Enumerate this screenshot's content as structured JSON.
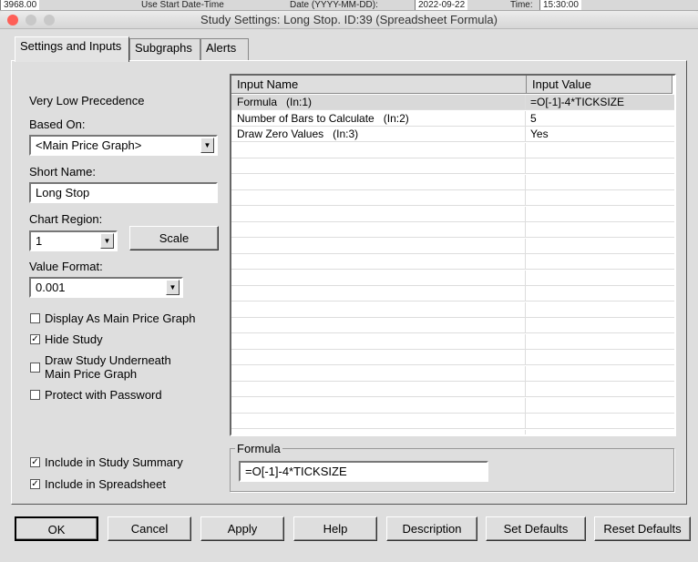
{
  "background_app": {
    "price": "3968.00",
    "use_start": "Use Start Date-Time",
    "date_label": "Date (YYYY-MM-DD):",
    "date_value": "2022-09-22",
    "time_label": "Time:",
    "time_value": "15:30:00"
  },
  "window": {
    "title": "Study Settings: Long Stop. ID:39 (Spreadsheet Formula)"
  },
  "tabs": [
    {
      "label": "Settings and Inputs"
    },
    {
      "label": "Subgraphs"
    },
    {
      "label": "Alerts"
    }
  ],
  "settings": {
    "precedence": "Very Low Precedence",
    "based_on_label": "Based On:",
    "based_on_value": "<Main Price Graph>",
    "short_name_label": "Short Name:",
    "short_name_value": "Long Stop",
    "chart_region_label": "Chart Region:",
    "chart_region_value": "1",
    "scale_label": "Scale",
    "value_format_label": "Value Format:",
    "value_format_value": "0.001",
    "checkboxes": [
      {
        "label": "Display As Main Price Graph",
        "checked": false
      },
      {
        "label": "Hide Study",
        "checked": true
      },
      {
        "label": "Draw Study Underneath",
        "label2": "Main Price Graph",
        "checked": false
      },
      {
        "label": "Protect with Password",
        "checked": false
      },
      {
        "label": "Include in Study Summary",
        "checked": true
      },
      {
        "label": "Include in Spreadsheet",
        "checked": true
      }
    ]
  },
  "inputs": {
    "col_name": "Input Name",
    "col_value": "Input Value",
    "rows": [
      {
        "name": "Formula   (In:1)",
        "value": "=O[-1]-4*TICKSIZE"
      },
      {
        "name": "Number of Bars to Calculate   (In:2)",
        "value": "5"
      },
      {
        "name": "Draw Zero Values   (In:3)",
        "value": "Yes"
      }
    ]
  },
  "formula": {
    "label": "Formula",
    "value": "=O[-1]-4*TICKSIZE"
  },
  "buttons": {
    "ok": "OK",
    "cancel": "Cancel",
    "apply": "Apply",
    "help": "Help",
    "description": "Description",
    "set_defaults": "Set Defaults",
    "reset_defaults": "Reset Defaults"
  },
  "colors": {
    "close": "#fe5f57",
    "selected_row": "#d9d9d9"
  }
}
